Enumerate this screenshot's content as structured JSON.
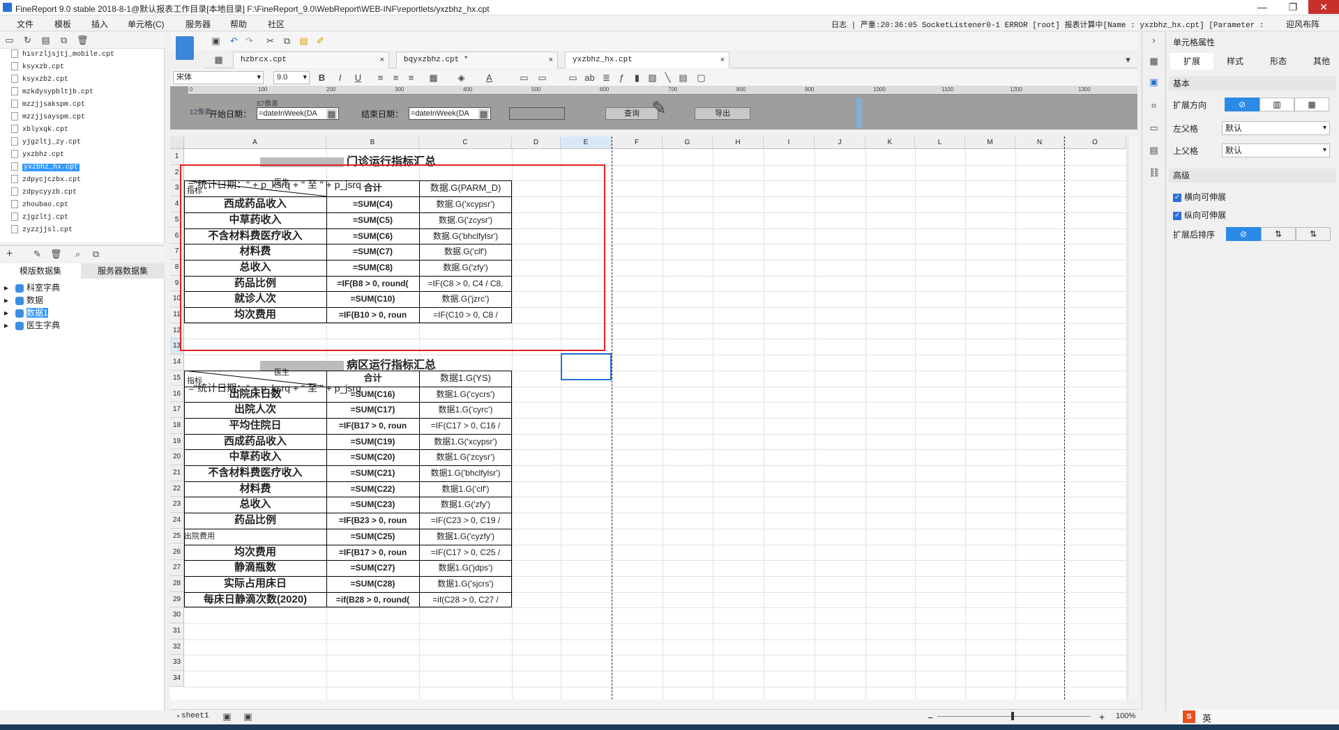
{
  "window": {
    "title": "FineReport 9.0 stable 2018-8-1@默认报表工作目录[本地目录]    F:\\FineReport_9.0\\WebReport\\WEB-INF\\reportlets/yxzbhz_hx.cpt"
  },
  "menu": [
    "文件",
    "模板",
    "插入",
    "单元格(C)",
    "服务器",
    "帮助",
    "社区"
  ],
  "log_line": "日志 | 严重:20:36:05 SocketListener0-1 ERROR [root] 报表计算中[Name : yxzbhz_hx.cpt] [Parameter :",
  "welcome_label": "迎风布阵",
  "files": [
    "hisrzljsjtj_mobile.cpt",
    "ksyxzb.cpt",
    "ksyxzb2.cpt",
    "mzkdysypbltjb.cpt",
    "mzzjjsakspm.cpt",
    "mzzjjsayspm.cpt",
    "xblyxqk.cpt",
    "yjgzltj_zy.cpt",
    "yxzbhz.cpt",
    "yxzbhz_hx.cpt",
    "zdpycjczbx.cpt",
    "zdpycyyzb.cpt",
    "zhoubao.cpt",
    "zjgzltj.cpt",
    "zyzzjjsl.cpt"
  ],
  "selected_file": "yxzbhz_hx.cpt",
  "dataset_tabs": [
    "模版数据集",
    "服务器数据集"
  ],
  "datasets": [
    "科室字典",
    "数据",
    "数据1",
    "医生字典"
  ],
  "selected_dataset": "数据1",
  "file_tabs": [
    "hzbrcx.cpt",
    "bqyxzbhz.cpt *",
    "yxzbhz_hx.cpt"
  ],
  "format": {
    "font": "宋体",
    "size": "9.0"
  },
  "ruler_ticks": [
    "0",
    "100",
    "200",
    "300",
    "400",
    "500",
    "600",
    "700",
    "800",
    "900",
    "1000",
    "1100",
    "1200",
    "1300"
  ],
  "params": {
    "start_label": "开始日期：",
    "end_label": "结束日期：",
    "start_value": "=dateInWeek(DA",
    "end_value": "=dateInWeek(DA",
    "query_label": "查询",
    "export_label": "导出",
    "px_label": "87像素",
    "px_label2": "12像素"
  },
  "columns": [
    "A",
    "B",
    "C",
    "D",
    "E",
    "F",
    "G",
    "H",
    "I",
    "J",
    "K",
    "L",
    "M",
    "N",
    "O"
  ],
  "active_column": "E",
  "active_row": "13",
  "sheet": {
    "title1": "门诊运行指标汇总",
    "title2": "病区运行指标汇总",
    "date_formula": "=\"统计日期：\" + p_ksrq + \" 至 \" + p_jsrq",
    "header_doctor": "医生",
    "header_indicator": "指标",
    "header_total": "合计",
    "t1_c3": "数据.G(PARM_D)",
    "t2_c15": "数据1.G(YS)",
    "t1_rows": [
      [
        "西成药品收入",
        "=SUM(C4)",
        "数据.G('xcypsr')"
      ],
      [
        "中草药收入",
        "=SUM(C5)",
        "数据.G('zcysr')"
      ],
      [
        "不含材料费医疗收入",
        "=SUM(C6)",
        "数据.G('bhclfylsr')"
      ],
      [
        "材料费",
        "=SUM(C7)",
        "数据.G('clf')"
      ],
      [
        "总收入",
        "=SUM(C8)",
        "数据.G('zfy')"
      ],
      [
        "药品比例",
        "=IF(B8 > 0, round(",
        "=IF(C8 > 0, C4 / C8,"
      ],
      [
        "就诊人次",
        "=SUM(C10)",
        "数据.G('jzrc')"
      ],
      [
        "均次费用",
        "=IF(B10 > 0, roun",
        "=IF(C10 > 0, C8 /"
      ]
    ],
    "t2_rows": [
      [
        "出院床日数",
        "=SUM(C16)",
        "数据1.G('cycrs')"
      ],
      [
        "出院人次",
        "=SUM(C17)",
        "数据1.G('cyrc')"
      ],
      [
        "平均住院日",
        "=IF(B17 > 0, roun",
        "=IF(C17 > 0, C16 /"
      ],
      [
        "西成药品收入",
        "=SUM(C19)",
        "数据1.G('xcypsr')"
      ],
      [
        "中草药收入",
        "=SUM(C20)",
        "数据1.G('zcysr')"
      ],
      [
        "不含材料费医疗收入",
        "=SUM(C21)",
        "数据1.G('bhclfylsr')"
      ],
      [
        "材料费",
        "=SUM(C22)",
        "数据1.G('clf')"
      ],
      [
        "总收入",
        "=SUM(C23)",
        "数据1.G('zfy')"
      ],
      [
        "药品比例",
        "=IF(B23 > 0, roun",
        "=IF(C23 > 0, C19 /"
      ],
      [
        "出院费用",
        "=SUM(C25)",
        "数据1.G('cyzfy')"
      ],
      [
        "均次费用",
        "=IF(B17 > 0, roun",
        "=IF(C17 > 0, C25 /"
      ],
      [
        "静滴瓶数",
        "=SUM(C27)",
        "数据1.G('jdps')"
      ],
      [
        "实际占用床日",
        "=SUM(C28)",
        "数据1.G('sjcrs')"
      ],
      [
        "每床日静滴次数(2020)",
        "=if(B28 > 0, round(",
        "=if(C28 > 0, C27 /"
      ]
    ]
  },
  "sheet_tab": "sheet1",
  "zoom": "100%",
  "right_panel": {
    "title": "单元格属性",
    "tabs": [
      "扩展",
      "样式",
      "形态",
      "其他"
    ],
    "basic": "基本",
    "expand_dir": "扩展方向",
    "left_parent": "左父格",
    "top_parent": "上父格",
    "default": "默认",
    "advanced": "高级",
    "h_expand": "横向可伸展",
    "v_expand": "纵向可伸展",
    "sort": "扩展后排序"
  },
  "ime_label": "英"
}
